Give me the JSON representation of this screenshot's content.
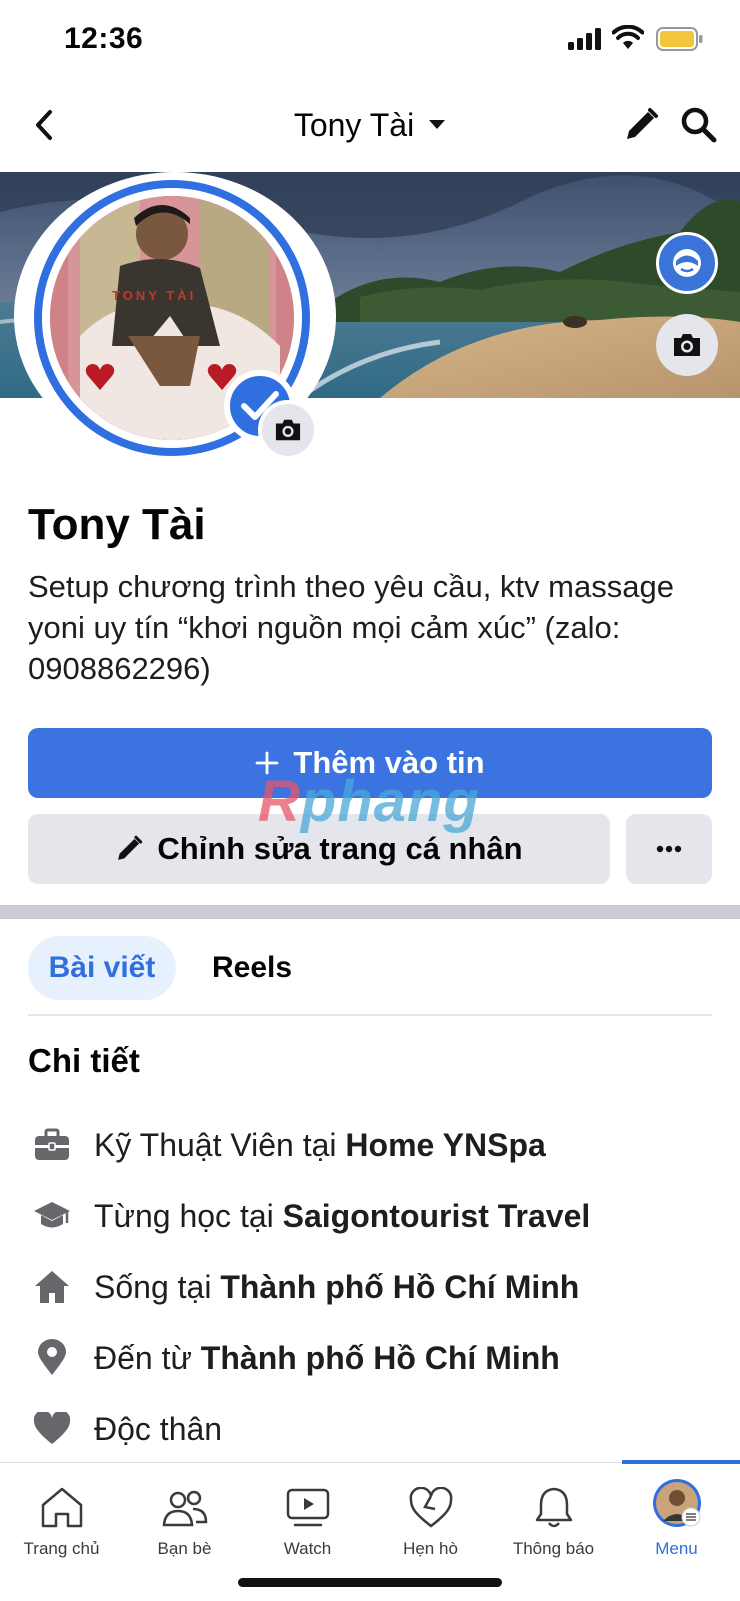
{
  "status_bar": {
    "time": "12:36"
  },
  "nav": {
    "title": "Tony Tài"
  },
  "profile": {
    "name": "Tony Tài",
    "bio": "Setup chương trình theo yêu cầu, ktv massage yoni uy tín “khơi nguồn mọi cảm xúc” (zalo: 0908862296)",
    "photo_text": "TONY TÀI"
  },
  "actions": {
    "add_story_label": "Thêm vào tin",
    "edit_profile_label": "Chỉnh sửa trang cá nhân"
  },
  "watermark": {
    "part1": "R",
    "part2": "phang"
  },
  "tabs": [
    {
      "label": "Bài viết",
      "active": true
    },
    {
      "label": "Reels",
      "active": false
    }
  ],
  "details": {
    "heading": "Chi tiết",
    "items": [
      {
        "icon": "briefcase-icon",
        "prefix": "Kỹ Thuật Viên tại ",
        "bold": "Home YNSpa"
      },
      {
        "icon": "graduation-cap-icon",
        "prefix": "Từng học tại ",
        "bold": "Saigontourist Travel"
      },
      {
        "icon": "house-icon",
        "prefix": "Sống tại ",
        "bold": "Thành phố Hồ Chí Minh"
      },
      {
        "icon": "location-pin-icon",
        "prefix": "Đến từ ",
        "bold": "Thành phố Hồ Chí Minh"
      },
      {
        "icon": "heart-icon",
        "prefix": "Độc thân",
        "bold": ""
      }
    ]
  },
  "bottom_nav": [
    {
      "label": "Trang chủ",
      "icon": "home-icon"
    },
    {
      "label": "Bạn bè",
      "icon": "friends-icon"
    },
    {
      "label": "Watch",
      "icon": "watch-icon"
    },
    {
      "label": "Hẹn hò",
      "icon": "dating-heart-icon"
    },
    {
      "label": "Thông báo",
      "icon": "bell-icon"
    },
    {
      "label": "Menu",
      "icon": "menu-avatar-icon",
      "active": true
    }
  ],
  "colors": {
    "accent": "#3b74e0",
    "badge": "#2f6fe0",
    "button_gray": "#e4e6eb"
  }
}
